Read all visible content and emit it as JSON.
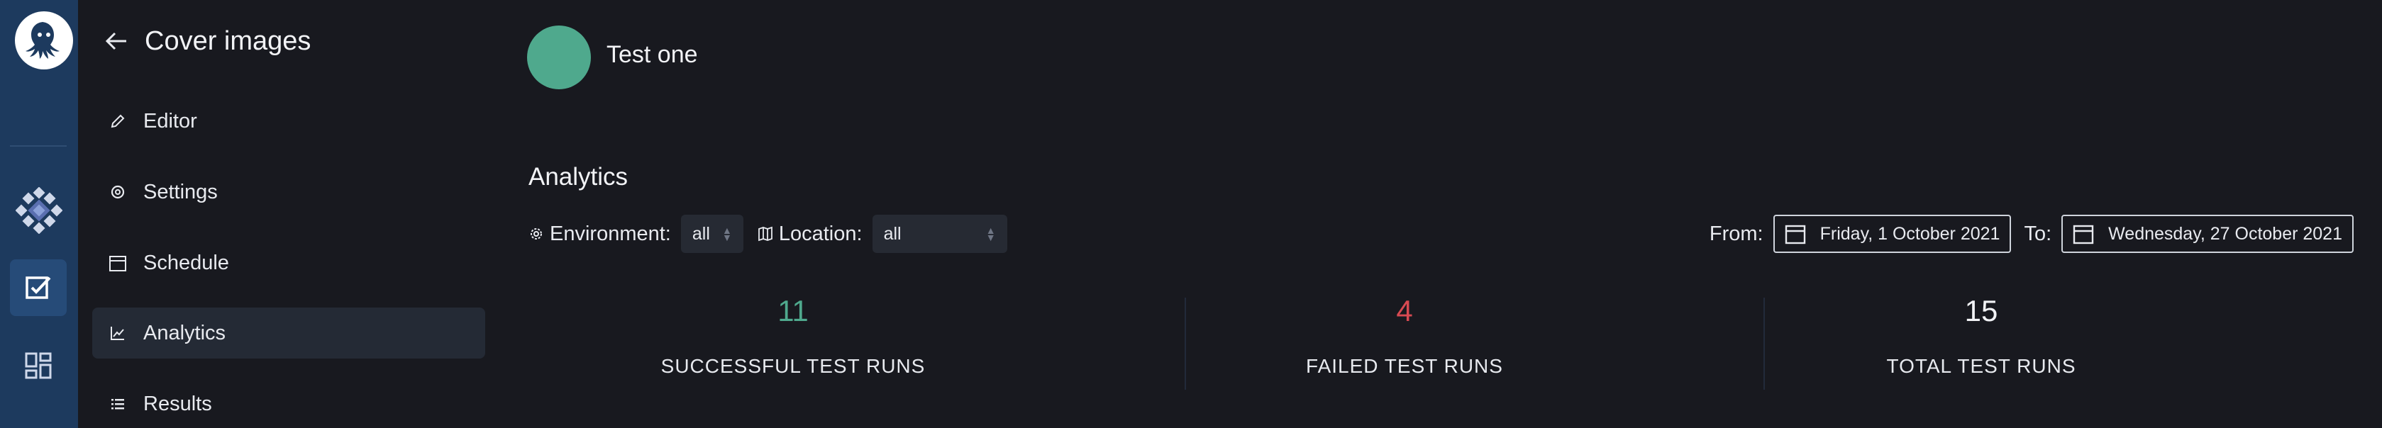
{
  "sidebar": {
    "title": "Cover images",
    "items": [
      {
        "label": "Editor",
        "icon": "pencil-icon",
        "active": false
      },
      {
        "label": "Settings",
        "icon": "settings-icon",
        "active": false
      },
      {
        "label": "Schedule",
        "icon": "calendar-icon",
        "active": false
      },
      {
        "label": "Analytics",
        "icon": "chart-line-icon",
        "active": true
      },
      {
        "label": "Results",
        "icon": "list-icon",
        "active": false
      }
    ]
  },
  "test": {
    "name": "Test one",
    "avatar_color": "#4fa98d"
  },
  "analytics": {
    "title": "Analytics",
    "environment_label": "Environment:",
    "environment_value": "all",
    "location_label": "Location:",
    "location_value": "all",
    "from_label": "From:",
    "from_date": "Friday, 1 October 2021",
    "to_label": "To:",
    "to_date": "Wednesday, 27 October 2021"
  },
  "stats": [
    {
      "value": "11",
      "label": "SUCCESSFUL TEST RUNS",
      "color": "#4fa98d"
    },
    {
      "value": "4",
      "label": "FAILED TEST RUNS",
      "color": "#d84a52"
    },
    {
      "value": "15",
      "label": "TOTAL TEST RUNS",
      "color": "#f2f3f6"
    }
  ],
  "colors": {
    "rail": "#1d3a5e",
    "background": "#18191f",
    "active_nav": "#242a35"
  }
}
